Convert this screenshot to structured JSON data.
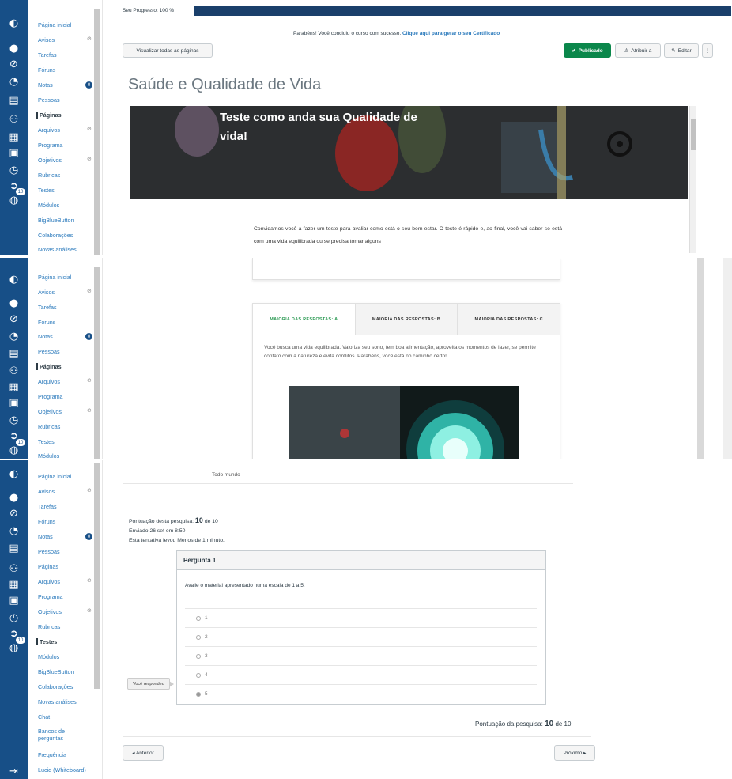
{
  "sidebar": {
    "items_panel1": [
      "Página inicial",
      "Avisos",
      "Tarefas",
      "Fóruns",
      "Notas",
      "Pessoas",
      "Páginas",
      "Arquivos",
      "Programa",
      "Objetivos",
      "Rubricas",
      "Testes",
      "Módulos",
      "BigBlueButton",
      "Colaborações",
      "Novas análises"
    ],
    "items_panel2": [
      "Página inicial",
      "Avisos",
      "Tarefas",
      "Fóruns",
      "Notas",
      "Pessoas",
      "Páginas",
      "Arquivos",
      "Programa",
      "Objetivos",
      "Rubricas",
      "Testes",
      "Módulos"
    ],
    "items_panel3": [
      "Página inicial",
      "Avisos",
      "Tarefas",
      "Fóruns",
      "Notas",
      "Pessoas",
      "Páginas",
      "Arquivos",
      "Programa",
      "Objetivos",
      "Rubricas",
      "Testes",
      "Módulos",
      "BigBlueButton",
      "Colaborações",
      "Novas análises",
      "Chat",
      "Bancos de perguntas",
      "Frequência",
      "Lucid (Whiteboard)"
    ],
    "notas_badge": "0",
    "global_badge": "10"
  },
  "panel1": {
    "progress_label": "Seu Progresso: 100 %",
    "progress_value": 1.0,
    "congrats_text": "Parabéns! Você concluiu o curso com sucesso.",
    "congrats_link": "Clique aqui para gerar o seu Certificado",
    "view_all_pages": "Visualizar todas as páginas",
    "published": "Publicado",
    "assign_to": "Atribuir a",
    "edit": "Editar",
    "page_title": "Saúde e Qualidade de Vida",
    "banner_title": "Teste como anda sua Qualidade de vida!",
    "intro_text": "Convidamos você a fazer um teste para avaliar como está o seu bem-estar. O teste é rápido e, ao final, você vai saber se está com uma vida equilibrada ou se precisa tomar alguns"
  },
  "panel2": {
    "tabs": [
      "MAIORIA DAS RESPOSTAS: A",
      "MAIORIA DAS RESPOSTAS: B",
      "MAIORIA DAS RESPOSTAS: C"
    ],
    "tab_text": "Você busca uma vida equilibrada. Valoriza seu sono, tem boa alimentação, aproveita os momentos de lazer, se permite contato com a natureza e evita conflitos. Parabéns, você está no caminho certo!"
  },
  "panel3": {
    "table_row_label": "Todo mundo",
    "table_dash": "-",
    "score_prefix": "Pontuação desta pesquisa:",
    "score_value": "10",
    "score_suffix": "de 10",
    "sent": "Enviado 26 set em 8:50",
    "duration": "Esta tentativa levou Menos de 1 minuto.",
    "question_title": "Pergunta 1",
    "question_text": "Avalie o material apresentado numa escala de 1 a 5.",
    "answers": [
      "1",
      "2",
      "3",
      "4",
      "5"
    ],
    "your_answer": "Você respondeu",
    "final_prefix": "Pontuação da pesquisa:",
    "final_value": "10",
    "final_suffix": "de 10",
    "prev": "◂ Anterior",
    "next": "Próximo ▸"
  }
}
